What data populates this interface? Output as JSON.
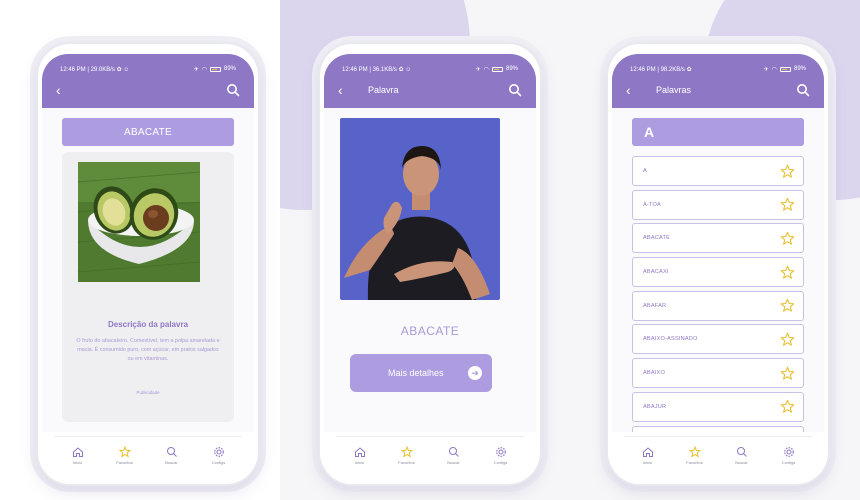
{
  "status_bar": [
    {
      "time_speed": "12:46 PM | 29.0KB/s",
      "icons": "✿ ☺",
      "battery": "89%"
    },
    {
      "time_speed": "12:46 PM | 36.1KB/s",
      "icons": "✿ ☺",
      "battery": "89%"
    },
    {
      "time_speed": "12:46 PM | 98.2KB/s",
      "icons": "✿",
      "battery": "89%"
    }
  ],
  "nav": {
    "back_icon": "‹",
    "screen2_title": "Palavra",
    "screen3_title": "Palavras"
  },
  "detail_screen": {
    "word": "ABACATE",
    "description_title": "Descrição da palavra",
    "description_text": "O fruto do abacateiro. Comestível, tem a polpa amarelada e macia. É consumido puro, com açúcar, em pratos salgados ou em vitaminas.",
    "ads_label": "Publicidade"
  },
  "sign_screen": {
    "word": "ABACATE",
    "more_button": "Mais detalhes",
    "arrow_icon": "➜"
  },
  "list_screen": {
    "letter": "A",
    "words": [
      "A",
      "À-TOA",
      "ABACATE",
      "ABACAXI",
      "ABAFAR",
      "ABAIXO-ASSINADO",
      "ABAIXO",
      "ABAJUR"
    ]
  },
  "bottom_nav": {
    "items": [
      {
        "label": "Início",
        "icon": "home-icon"
      },
      {
        "label": "Favoritos",
        "icon": "star-icon"
      },
      {
        "label": "Buscar",
        "icon": "search-icon"
      },
      {
        "label": "Configs",
        "icon": "gear-icon"
      }
    ]
  },
  "colors": {
    "primary": "#8e78c6",
    "accent_light": "#ad9ce0",
    "star": "#e8c02e"
  }
}
